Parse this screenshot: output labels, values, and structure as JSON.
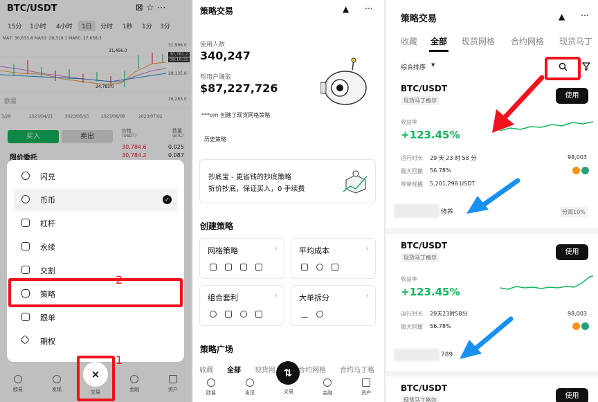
{
  "panel1": {
    "title": "BTC/USDT",
    "header_icons": "⊠ ☆ ⋯",
    "timeframes": [
      "15分",
      "1小时",
      "4小时",
      "1日",
      "分时",
      "1秒",
      "1分",
      "3分"
    ],
    "selected_timeframe": "1日",
    "ma_line": "MA7: 30,633.8  MA30: 28,319.1  MA60: 27,658.3",
    "price_high": "31,996.0",
    "price_mark": "31,456.0",
    "price_current": "30,781.2",
    "price_timer": "08:10:31",
    "price_mid": "28,135.0",
    "price_low_label": "24,783.0",
    "price_axis_bottom": "26,283.0",
    "x_ticks": [
      "3/29",
      "2023/04/21",
      "2023/05/15",
      "2023/06/08",
      "2023/07/02"
    ],
    "watermark": "欧易",
    "buy_label": "买入",
    "sell_label": "卖出",
    "order_type": "限价委托",
    "book_headers": [
      "价格",
      "数量"
    ],
    "book_units": [
      "(USDT)",
      "(BTC)"
    ],
    "book_rows": [
      {
        "price": "30,784.6",
        "qty": "0.025"
      },
      {
        "price": "30,784.2",
        "qty": "0.087"
      }
    ],
    "menu_items": [
      {
        "label": "闪兑",
        "icon": "swap-icon"
      },
      {
        "label": "币币",
        "icon": "coin-icon",
        "checked": true
      },
      {
        "label": "杠杆",
        "icon": "leverage-icon"
      },
      {
        "label": "永续",
        "icon": "perpetual-icon"
      },
      {
        "label": "交割",
        "icon": "delivery-icon"
      },
      {
        "label": "策略",
        "icon": "robot-icon"
      },
      {
        "label": "跟单",
        "icon": "copy-trade-icon"
      },
      {
        "label": "期权",
        "icon": "options-icon"
      }
    ],
    "annotation_1": "1",
    "annotation_2": "2",
    "nav": [
      "欧易",
      "发现",
      "交易",
      "金融",
      "资产"
    ],
    "close_glyph": "×",
    "check_glyph": "✓"
  },
  "panel2": {
    "title": "策略交易",
    "users_label": "使用人数",
    "users_value": "340,247",
    "earned_label": "帮用户赚取",
    "earned_value": "$87,227,726",
    "activity": "***om 创建了现货网格策略",
    "history": "历史策略",
    "promo_title": "抄底宝 - 更省钱的抄底策略",
    "promo_sub": "折价抄底，保证买入，0 手续费",
    "create_section": "创建策略",
    "cards": [
      "网格策略",
      "平均成本",
      "组合套利",
      "大单拆分"
    ],
    "square_section": "策略广场",
    "square_tabs": [
      "收藏",
      "全部",
      "现货网",
      "合约网格",
      "合约马丁格"
    ],
    "nav": [
      "欧易",
      "发现",
      "交易",
      "金融",
      "资产"
    ]
  },
  "panel3": {
    "title": "策略交易",
    "tabs": [
      "收藏",
      "全部",
      "现货网格",
      "合约网格",
      "现货马丁"
    ],
    "active_tab": "全部",
    "sort_label": "综合排序",
    "strategies": [
      {
        "pair": "BTC/USDT",
        "tag": "现货马丁格尔",
        "use": "使用",
        "yield_label": "收益率",
        "yield": "+123.45%",
        "runtime_label": "运行时长",
        "runtime": "29 天 23 时 58 分",
        "users": "98,003",
        "drawdown_label": "最大回撤",
        "drawdown": "56.78%",
        "volume_label": "带单规模",
        "volume": "5,201,298 USDT",
        "author_suffix": "修养",
        "share": "分润10%"
      },
      {
        "pair": "BTC/USDT",
        "tag": "现货马丁格尔",
        "use": "使用",
        "yield_label": "收益率",
        "yield": "+123.45%",
        "runtime_label": "运行时长",
        "runtime": "29天23时58分",
        "users": "98,003",
        "drawdown_label": "最大回撤",
        "drawdown": "56.78%",
        "author_suffix": "789"
      },
      {
        "pair": "BTC/USDT",
        "tag": "现货马丁格尔",
        "use": "使用"
      }
    ]
  },
  "colors": {
    "green": "#10b55c",
    "red_annotation": "#f0121d",
    "blue_arrow": "#1890f0",
    "dark": "#111111"
  }
}
